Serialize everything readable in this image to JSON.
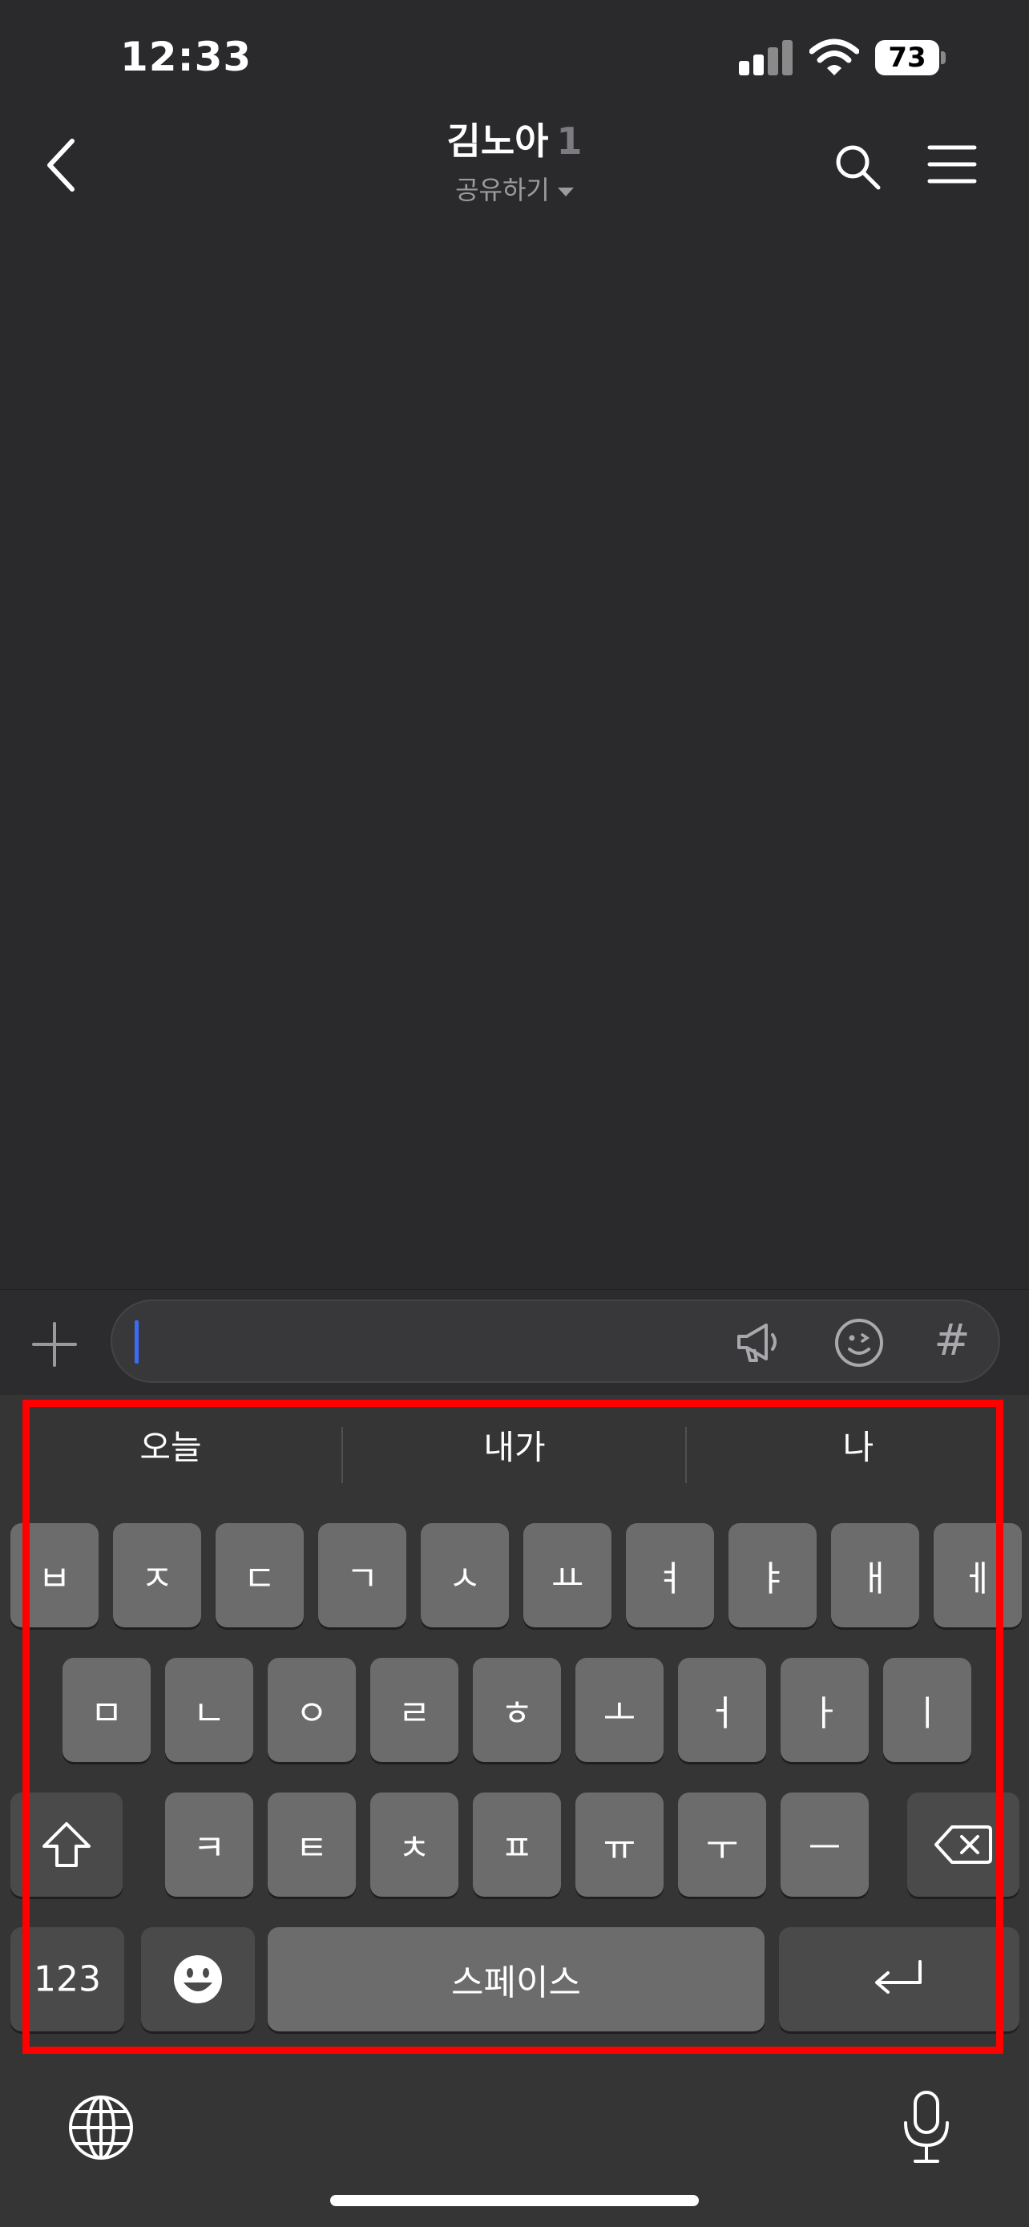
{
  "status": {
    "time": "12:33",
    "battery": "73"
  },
  "header": {
    "title": "김노아",
    "member_count": "1",
    "share_label": "공유하기"
  },
  "input": {
    "value": "",
    "placeholder": "",
    "hash_symbol": "#"
  },
  "keyboard": {
    "suggestions": [
      "오늘",
      "내가",
      "나"
    ],
    "row1": [
      "ㅂ",
      "ㅈ",
      "ㄷ",
      "ㄱ",
      "ㅅ",
      "ㅛ",
      "ㅕ",
      "ㅑ",
      "ㅐ",
      "ㅔ"
    ],
    "row2": [
      "ㅁ",
      "ㄴ",
      "ㅇ",
      "ㄹ",
      "ㅎ",
      "ㅗ",
      "ㅓ",
      "ㅏ",
      "ㅣ"
    ],
    "row3": [
      "ㅋ",
      "ㅌ",
      "ㅊ",
      "ㅍ",
      "ㅠ",
      "ㅜ",
      "ㅡ"
    ],
    "numbers_label": "123",
    "space_label": "스페이스"
  },
  "colors": {
    "background": "#2a2a2c",
    "key": "#6c6c6c",
    "key_dark": "#4a4a4a",
    "cursor": "#3b6cf5",
    "highlight": "#ff0000"
  },
  "icons": [
    "back-icon",
    "search-icon",
    "menu-icon",
    "plus-icon",
    "megaphone-icon",
    "emoticon-icon",
    "shift-icon",
    "backspace-icon",
    "emoji-icon",
    "return-icon",
    "globe-icon",
    "mic-icon"
  ]
}
